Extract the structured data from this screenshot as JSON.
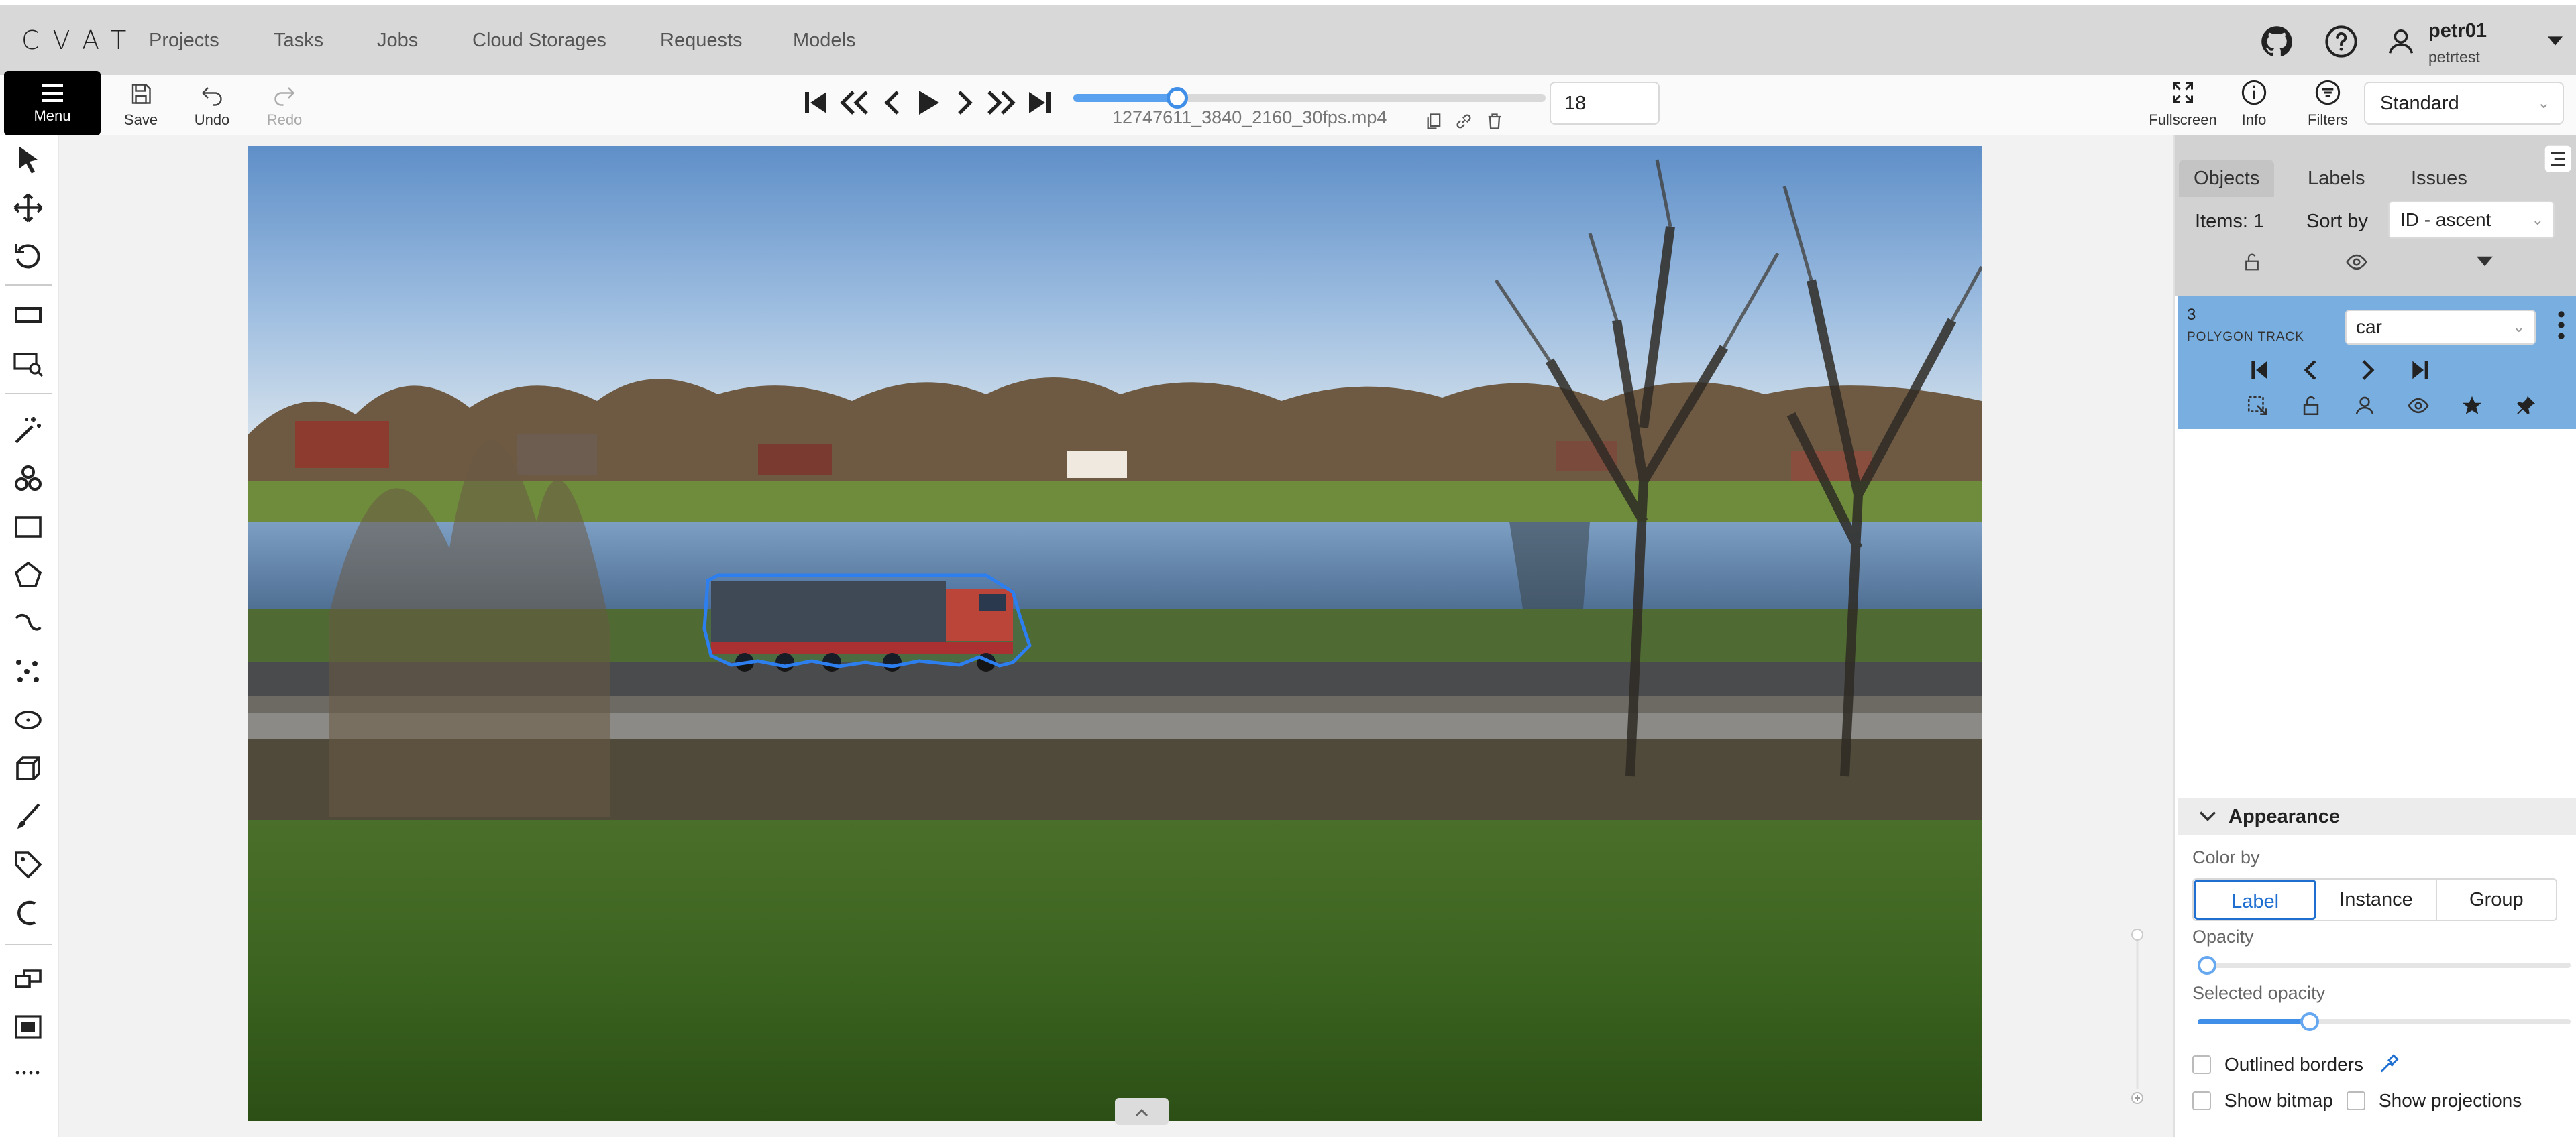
{
  "app": {
    "logo": "CVAT"
  },
  "nav": {
    "items": [
      "Projects",
      "Tasks",
      "Jobs",
      "Cloud Storages",
      "Requests",
      "Models"
    ]
  },
  "user": {
    "name": "petr01",
    "login": "petrtest"
  },
  "toolbar": {
    "menu_label": "Menu",
    "save_label": "Save",
    "undo_label": "Undo",
    "redo_label": "Redo",
    "filename": "12747611_3840_2160_30fps.mp4",
    "frame_number": "18",
    "frame_progress_percent": 22,
    "fullscreen_label": "Fullscreen",
    "info_label": "Info",
    "filters_label": "Filters",
    "workspace": "Standard"
  },
  "objects_panel": {
    "tabs": [
      "Objects",
      "Labels",
      "Issues"
    ],
    "active_tab": "Objects",
    "items_count": "Items: 1",
    "sort_label": "Sort by",
    "sort_value": "ID - ascent",
    "object": {
      "id": "3",
      "type": "POLYGON TRACK",
      "label": "car",
      "color": "#79aee0"
    }
  },
  "appearance": {
    "title": "Appearance",
    "color_by_label": "Color by",
    "color_by_options": [
      "Label",
      "Instance",
      "Group"
    ],
    "color_by_selected": "Label",
    "opacity_label": "Opacity",
    "opacity_percent": 2,
    "selected_opacity_label": "Selected opacity",
    "selected_opacity_percent": 30,
    "outlined_borders_label": "Outlined borders",
    "show_bitmap_label": "Show bitmap",
    "show_projections_label": "Show projections"
  },
  "colors": {
    "accent": "#1f6fd1",
    "object_card": "#79aee0",
    "polygon_outline": "#2d7ff0",
    "topbar": "#d8d8d8"
  }
}
